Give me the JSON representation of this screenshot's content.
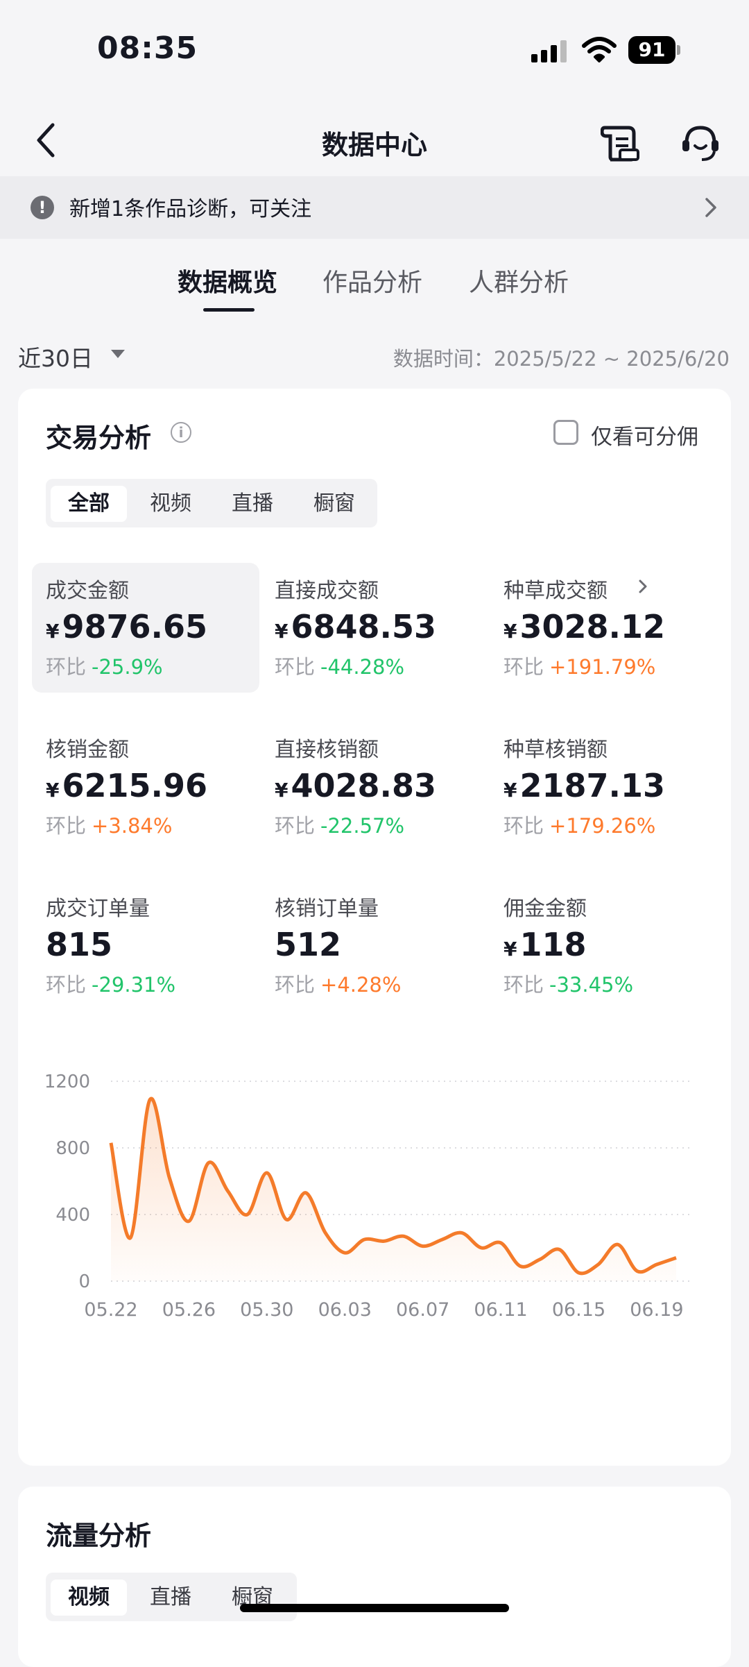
{
  "status": {
    "time": "08:35",
    "battery": "91"
  },
  "nav": {
    "title": "数据中心"
  },
  "notice": {
    "text": "新增1条作品诊断，可关注"
  },
  "tabs": [
    {
      "label": "数据概览",
      "active": true
    },
    {
      "label": "作品分析",
      "active": false
    },
    {
      "label": "人群分析",
      "active": false
    }
  ],
  "range": {
    "label": "近30日",
    "data_time": "数据时间：2025/5/22 ~ 2025/6/20"
  },
  "trade": {
    "title": "交易分析",
    "checkbox_label": "仅看可分佣",
    "segments": [
      "全部",
      "视频",
      "直播",
      "橱窗"
    ],
    "change_label": "环比",
    "metrics": [
      {
        "label": "成交金额",
        "currency": "¥",
        "value": "9876.65",
        "change": "-25.9%",
        "trend": "down"
      },
      {
        "label": "直接成交额",
        "currency": "¥",
        "value": "6848.53",
        "change": "-44.28%",
        "trend": "down"
      },
      {
        "label": "种草成交额",
        "currency": "¥",
        "value": "3028.12",
        "change": "+191.79%",
        "trend": "up"
      },
      {
        "label": "核销金额",
        "currency": "¥",
        "value": "6215.96",
        "change": "+3.84%",
        "trend": "up"
      },
      {
        "label": "直接核销额",
        "currency": "¥",
        "value": "4028.83",
        "change": "-22.57%",
        "trend": "down"
      },
      {
        "label": "种草核销额",
        "currency": "¥",
        "value": "2187.13",
        "change": "+179.26%",
        "trend": "up"
      },
      {
        "label": "成交订单量",
        "currency": "",
        "value": "815",
        "change": "-29.31%",
        "trend": "down"
      },
      {
        "label": "核销订单量",
        "currency": "",
        "value": "512",
        "change": "+4.28%",
        "trend": "up"
      },
      {
        "label": "佣金金额",
        "currency": "¥",
        "value": "118",
        "change": "-33.45%",
        "trend": "down"
      }
    ]
  },
  "chart_data": {
    "type": "area",
    "line_color": "#f47b2a",
    "ylim": [
      0,
      1200
    ],
    "yticks": [
      0,
      400,
      800,
      1200
    ],
    "xtick_labels": [
      "05.22",
      "05.26",
      "05.30",
      "06.03",
      "06.07",
      "06.11",
      "06.15",
      "06.19"
    ],
    "x": [
      "05.22",
      "05.23",
      "05.24",
      "05.25",
      "05.26",
      "05.27",
      "05.28",
      "05.29",
      "05.30",
      "05.31",
      "06.01",
      "06.02",
      "06.03",
      "06.04",
      "06.05",
      "06.06",
      "06.07",
      "06.08",
      "06.09",
      "06.10",
      "06.11",
      "06.12",
      "06.13",
      "06.14",
      "06.15",
      "06.16",
      "06.17",
      "06.18",
      "06.19",
      "06.20"
    ],
    "values": [
      830,
      260,
      1090,
      620,
      360,
      710,
      540,
      400,
      650,
      370,
      530,
      290,
      170,
      250,
      240,
      270,
      210,
      250,
      290,
      200,
      230,
      90,
      130,
      190,
      50,
      100,
      220,
      60,
      100,
      140
    ]
  },
  "traffic": {
    "title": "流量分析",
    "segments": [
      "视频",
      "直播",
      "橱窗"
    ]
  }
}
